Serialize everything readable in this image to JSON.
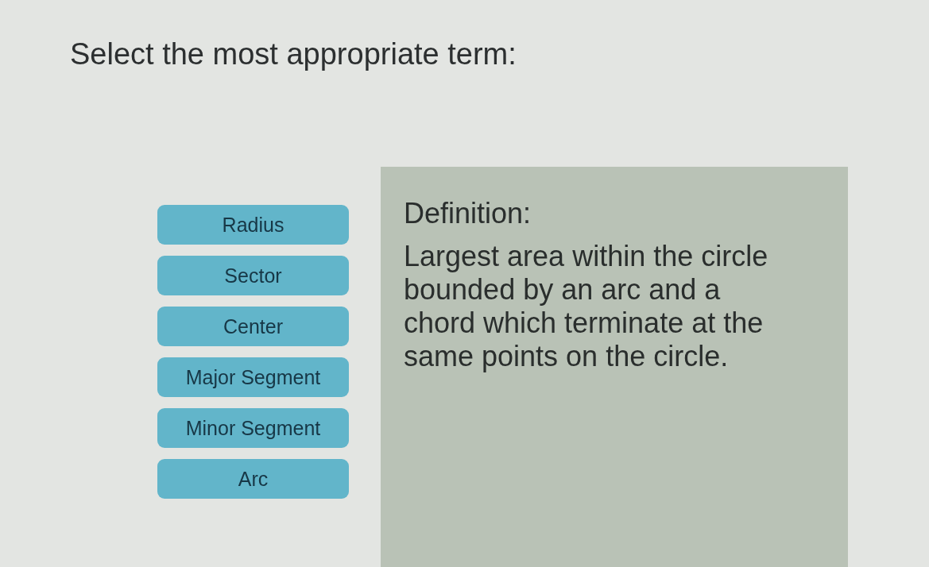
{
  "prompt": "Select the most appropriate term:",
  "terms": [
    "Radius",
    "Sector",
    "Center",
    "Major Segment",
    "Minor Segment",
    "Arc"
  ],
  "definition": {
    "heading": "Definition:",
    "text": "Largest area within the circle bounded by an arc and a chord which terminate at the same points on the circle."
  }
}
